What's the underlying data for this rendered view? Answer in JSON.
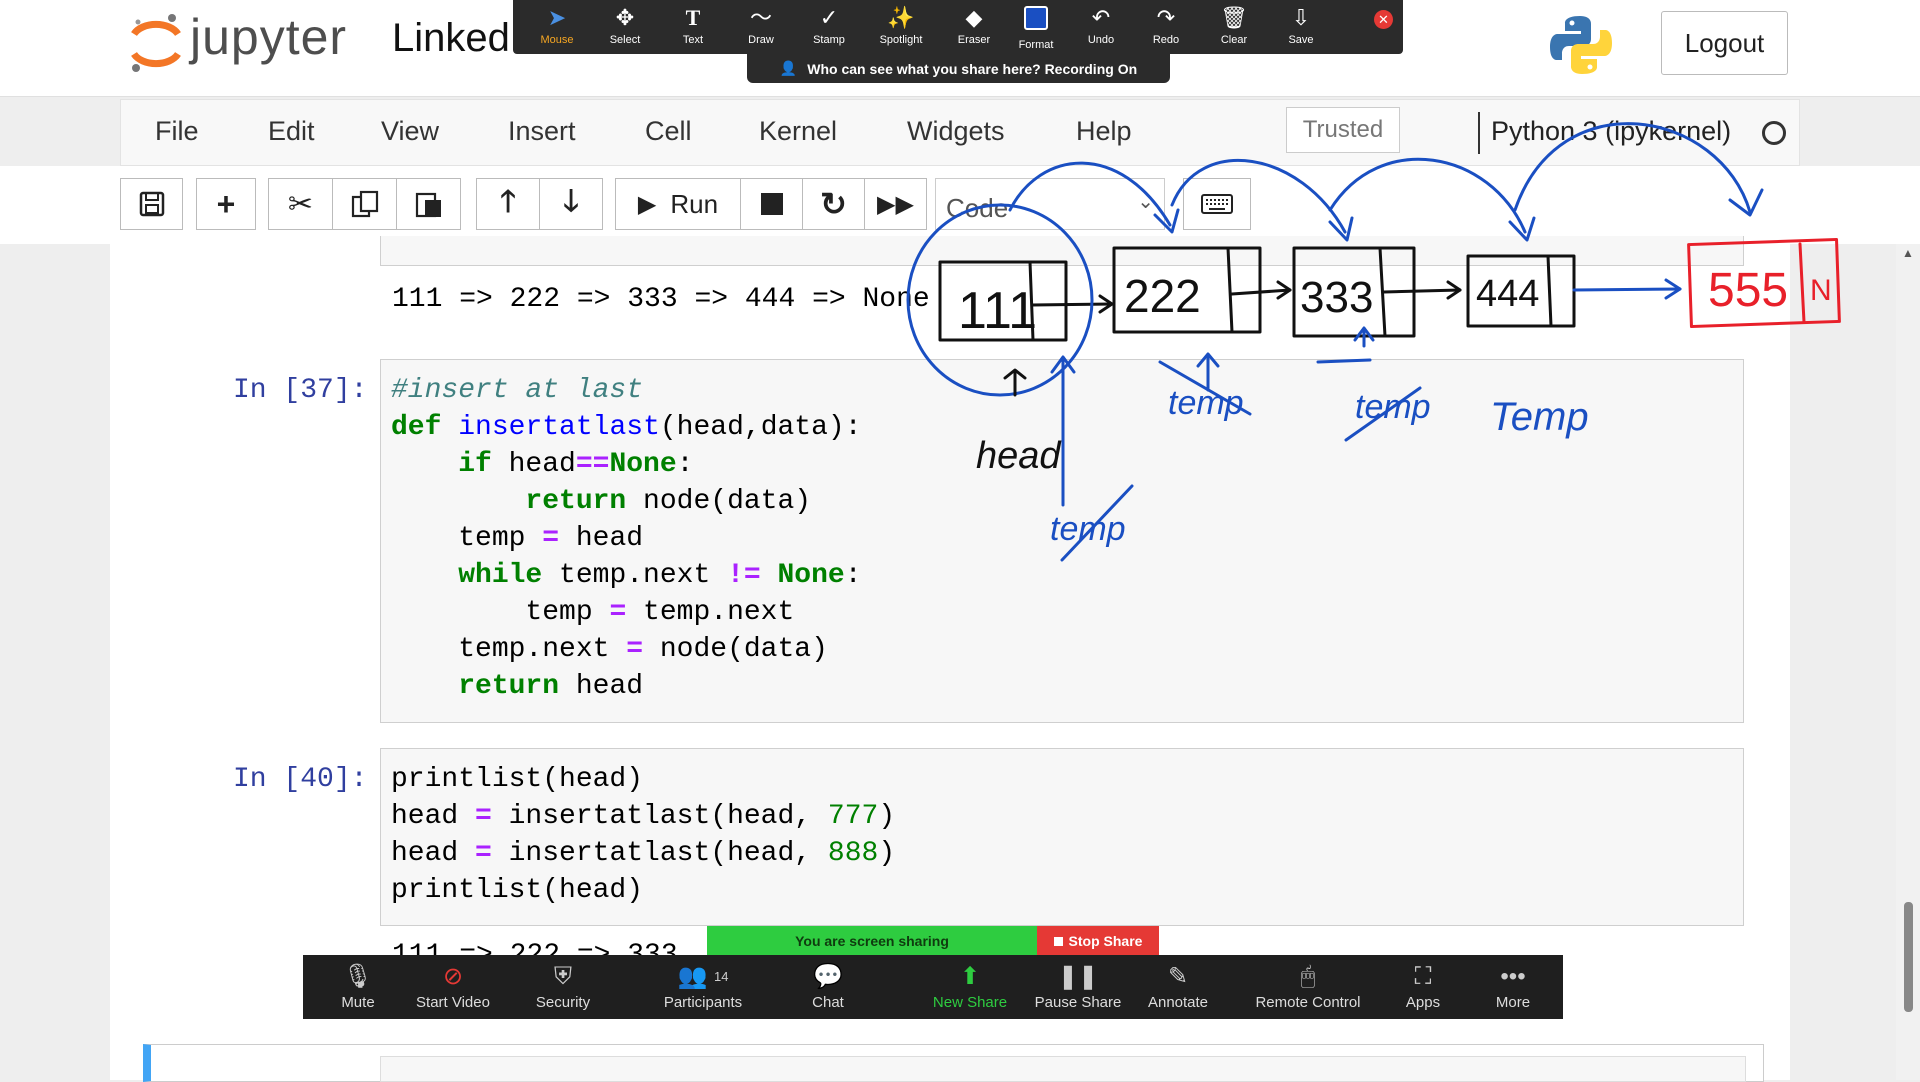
{
  "header": {
    "logo_text": "jupyter",
    "notebook_name": "Linked",
    "logout_label": "Logout"
  },
  "menubar": {
    "items": [
      "File",
      "Edit",
      "View",
      "Insert",
      "Cell",
      "Kernel",
      "Widgets",
      "Help"
    ],
    "trusted_label": "Trusted",
    "kernel_name": "Python 3 (ipykernel)"
  },
  "toolbar": {
    "run_label": "Run",
    "cell_type": "Code"
  },
  "annotate_toolbar": {
    "tools": [
      "Mouse",
      "Select",
      "Text",
      "Draw",
      "Stamp",
      "Spotlight",
      "Eraser",
      "Format",
      "Undo",
      "Redo",
      "Clear",
      "Save"
    ],
    "recording_text": "Who can see what you share here? Recording On"
  },
  "notebook": {
    "output_top": "111 => 222 => 333 => 444 => None",
    "cell37": {
      "prompt": "In [37]:",
      "lines": [
        "#insert at last",
        "def insertatlast(head,data):",
        "    if head==None:",
        "        return node(data)",
        "    temp = head",
        "    while temp.next != None:",
        "        temp = temp.next",
        "    temp.next = node(data)",
        "    return head"
      ]
    },
    "cell40": {
      "prompt": "In [40]:",
      "lines": [
        "printlist(head)",
        "head = insertatlast(head, 777)",
        "head = insertatlast(head, 888)",
        "printlist(head)"
      ]
    },
    "partial_output": "111 => 222 => 333"
  },
  "annotations": {
    "nodes": [
      "111",
      "222",
      "333",
      "444",
      "555"
    ],
    "new_node_pointer": "N",
    "head_label": "head",
    "temp_label": "Temp",
    "struck_temp_label": "temp"
  },
  "screen_share": {
    "status": "You are screen sharing",
    "stop_label": "Stop Share"
  },
  "zoom_bar": {
    "participants_count": "14",
    "items": [
      "Mute",
      "Start Video",
      "Security",
      "Participants",
      "Chat",
      "New Share",
      "Pause Share",
      "Annotate",
      "Remote Control",
      "Apps",
      "More"
    ]
  },
  "colors": {
    "ink_blue": "#1a4fc2",
    "ink_red": "#e8202a",
    "ink_black": "#111111",
    "prompt_blue": "#303f9f",
    "share_green": "#2ecc40"
  }
}
